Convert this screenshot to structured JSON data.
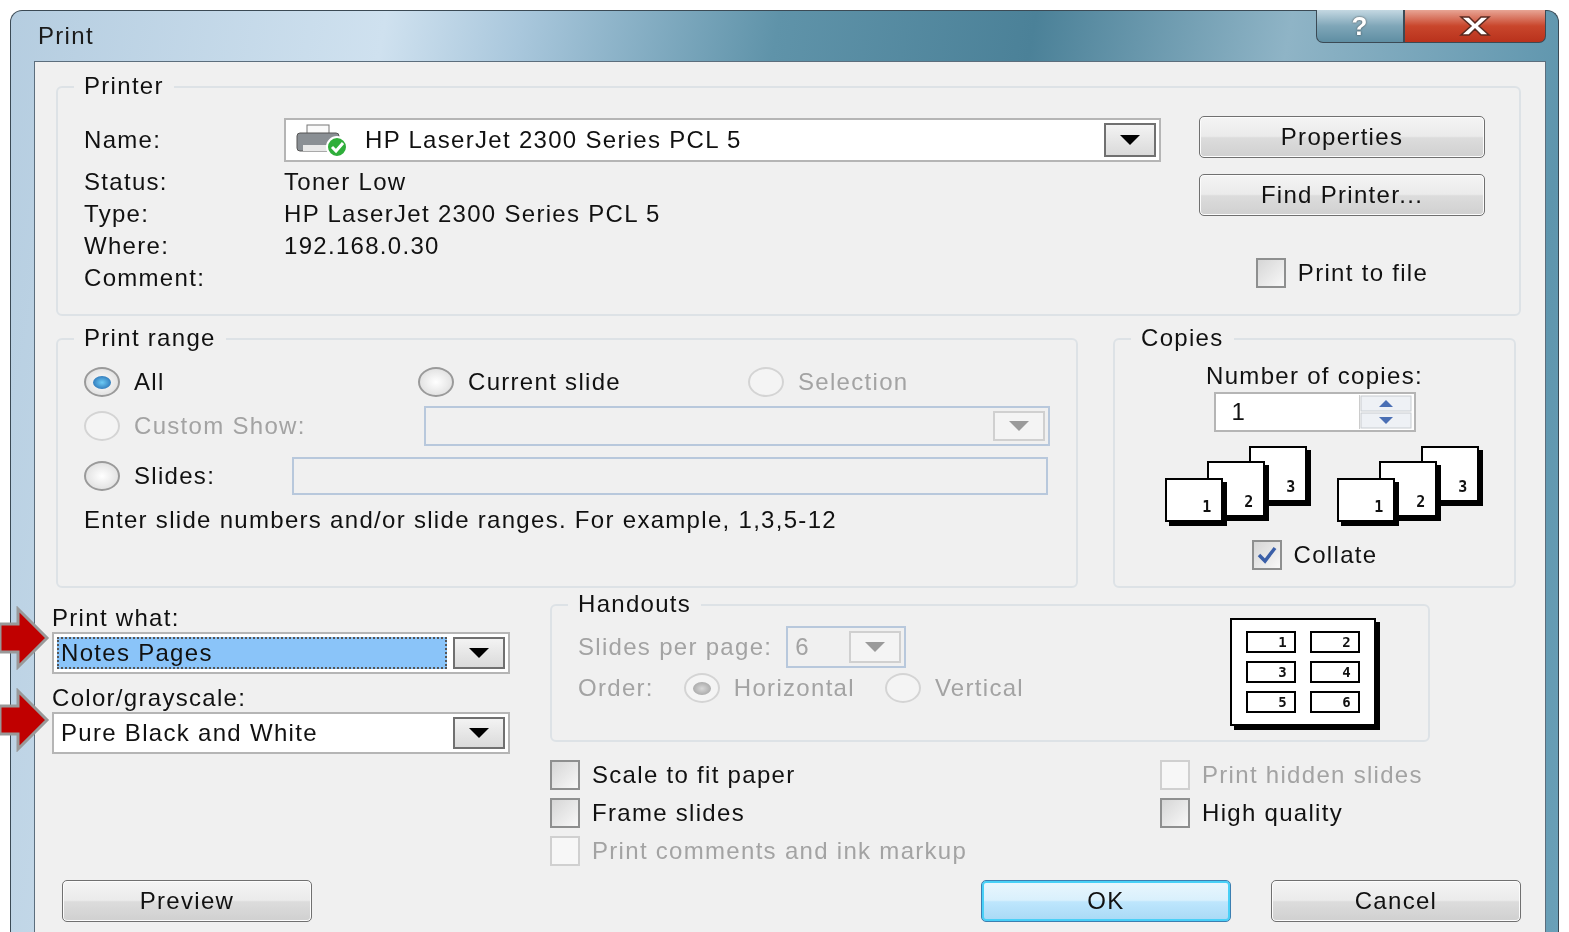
{
  "window": {
    "title": "Print",
    "help": "?"
  },
  "printer": {
    "legend": "Printer",
    "name_label": "Name:",
    "name_value": "HP LaserJet 2300 Series PCL 5",
    "status_label": "Status:",
    "status": "Toner Low",
    "type_label": "Type:",
    "type": "HP LaserJet 2300 Series PCL 5",
    "where_label": "Where:",
    "where": "192.168.0.30",
    "comment_label": "Comment:",
    "buttons": [
      "Properties",
      "Find Printer..."
    ],
    "print_to_file": {
      "label": "Print to file",
      "checked": false
    }
  },
  "print_range": {
    "legend": "Print range",
    "options": [
      {
        "label": "All",
        "selected": true,
        "disabled": false
      },
      {
        "label": "Current slide",
        "selected": false,
        "disabled": false
      },
      {
        "label": "Selection",
        "selected": false,
        "disabled": true
      },
      {
        "label": "Custom Show:",
        "selected": false,
        "disabled": true
      },
      {
        "label": "Slides:",
        "selected": false,
        "disabled": false
      }
    ],
    "hint": "Enter slide numbers and/or slide ranges. For example, 1,3,5-12"
  },
  "copies": {
    "legend": "Copies",
    "label": "Number of copies:",
    "value": "1",
    "stacks": [
      [
        "1",
        "2",
        "3"
      ],
      [
        "1",
        "2",
        "3"
      ]
    ],
    "collate": {
      "label": "Collate",
      "checked": true
    }
  },
  "print_what": {
    "label": "Print what:",
    "value": "Notes Pages",
    "focused": true
  },
  "color": {
    "label": "Color/grayscale:",
    "value": "Pure Black and White",
    "focused": false
  },
  "handouts": {
    "legend": "Handouts",
    "disabled": true,
    "per_page_label": "Slides per page:",
    "per_page": "6",
    "order_label": "Order:",
    "orders": [
      {
        "label": "Horizontal",
        "selected": true
      },
      {
        "label": "Vertical",
        "selected": false
      }
    ],
    "preview": [
      "1",
      "2",
      "3",
      "4",
      "5",
      "6"
    ]
  },
  "options_left": [
    {
      "label": "Scale to fit paper",
      "checked": false,
      "disabled": false
    },
    {
      "label": "Frame slides",
      "checked": false,
      "disabled": false
    },
    {
      "label": "Print comments and ink markup",
      "checked": false,
      "disabled": true
    }
  ],
  "options_right": [
    {
      "label": "Print hidden slides",
      "checked": false,
      "disabled": true
    },
    {
      "label": "High quality",
      "checked": false,
      "disabled": false
    }
  ],
  "buttons": [
    {
      "label": "Preview",
      "default": false
    },
    {
      "label": "OK",
      "default": true
    },
    {
      "label": "Cancel",
      "default": false
    }
  ]
}
